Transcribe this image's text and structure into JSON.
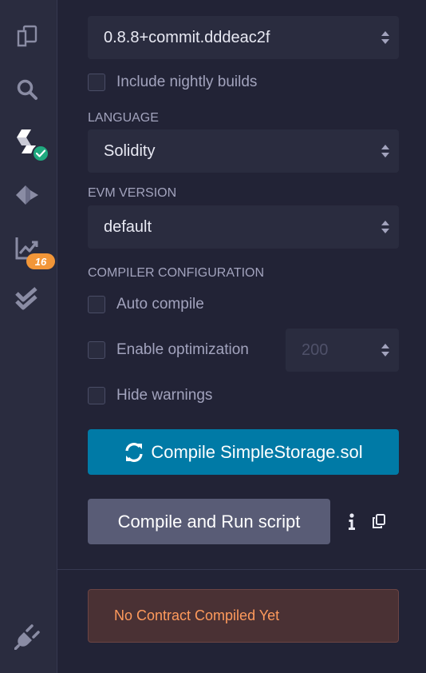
{
  "sidebar": {
    "icons": [
      {
        "name": "file-explorer-icon"
      },
      {
        "name": "search-icon"
      },
      {
        "name": "solidity-compiler-icon"
      },
      {
        "name": "deploy-run-icon"
      },
      {
        "name": "analysis-icon"
      },
      {
        "name": "unit-testing-icon"
      },
      {
        "name": "plugin-manager-icon"
      }
    ],
    "analysis_badge": "16",
    "colors": {
      "background": "#2a2c3f",
      "icon": "#8a8ca4",
      "check_badge": "#1fa97f",
      "count_badge": "#f29638"
    }
  },
  "compiler": {
    "version_value": "0.8.8+commit.dddeac2f",
    "nightly_label": "Include nightly builds",
    "language_label": "LANGUAGE",
    "language_value": "Solidity",
    "evm_label": "EVM VERSION",
    "evm_value": "default",
    "config_label": "COMPILER CONFIGURATION",
    "auto_compile_label": "Auto compile",
    "optimization_label": "Enable optimization",
    "runs_value": "200",
    "hide_warnings_label": "Hide warnings",
    "compile_button_label": "Compile SimpleStorage.sol",
    "run_script_button_label": "Compile and Run script"
  },
  "status": {
    "alert_text": "No Contract Compiled Yet"
  },
  "colors": {
    "page_bg": "#222336",
    "accent": "#007aa6",
    "secondary_button": "#595c76",
    "warning_text": "#ff9a5c",
    "warning_bg": "#4a3134"
  }
}
